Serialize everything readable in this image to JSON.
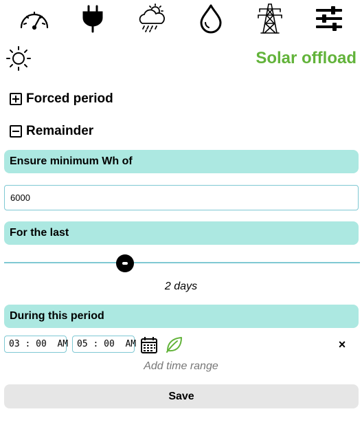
{
  "navbar": {
    "icons": [
      "gauge-icon",
      "plug-icon",
      "weather-icon",
      "water-drop-icon",
      "power-tower-icon",
      "sliders-icon"
    ]
  },
  "header": {
    "icon": "sun-icon",
    "title": "Solar offload"
  },
  "sections": {
    "forced_period": {
      "label": "Forced period",
      "expanded": false
    },
    "remainder": {
      "label": "Remainder",
      "expanded": true
    }
  },
  "ensure_minimum": {
    "label": "Ensure minimum Wh of",
    "value": "6000"
  },
  "for_the_last": {
    "label": "For the last",
    "value_text": "2 days",
    "slider_fraction": 0.34
  },
  "during_period": {
    "label": "During this period",
    "start_time": "03:00 AM",
    "start_display": "03 : 00  AM",
    "end_time": "05:00 AM",
    "end_display": "05 : 00  AM",
    "close_symbol": "×",
    "add_range_label": "Add time range"
  },
  "actions": {
    "save_label": "Save"
  },
  "colors": {
    "accent_green": "#62b33a",
    "label_bar_bg": "#ace8e1",
    "input_border": "#7ec8d3",
    "save_bg": "#e6e6e6"
  }
}
